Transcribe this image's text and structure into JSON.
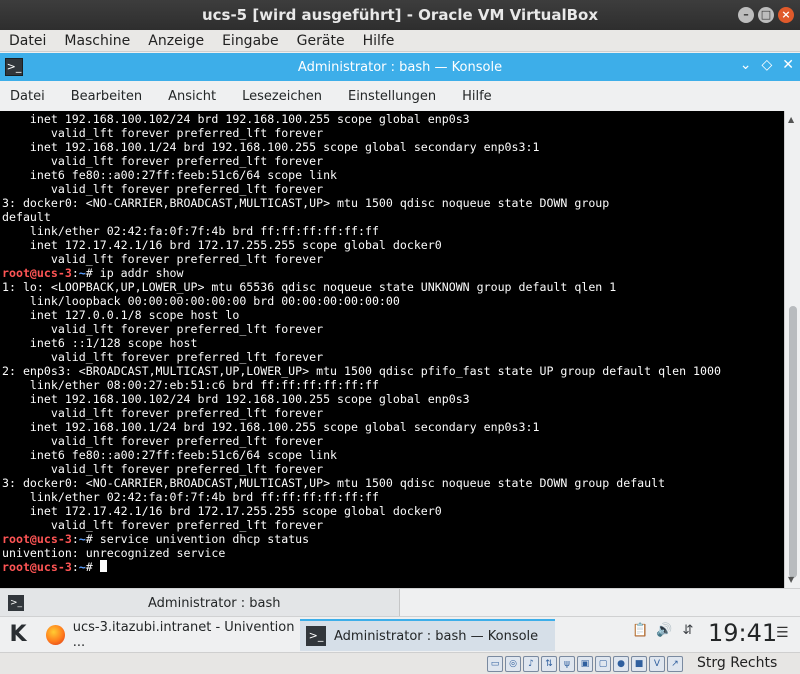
{
  "vbox": {
    "title": "ucs-5 [wird ausgeführt] - Oracle VM VirtualBox",
    "menu": [
      "Datei",
      "Maschine",
      "Anzeige",
      "Eingabe",
      "Geräte",
      "Hilfe"
    ],
    "host_key": "Strg Rechts"
  },
  "konsole": {
    "title": "Administrator : bash — Konsole",
    "menu": [
      "Datei",
      "Bearbeiten",
      "Ansicht",
      "Lesezeichen",
      "Einstellungen",
      "Hilfe"
    ],
    "tab_label": "Administrator : bash"
  },
  "terminal": {
    "prompt": {
      "user": "root",
      "host": "ucs-3",
      "path": "~"
    },
    "lines": [
      {
        "text": "    inet 192.168.100.102/24 brd 192.168.100.255 scope global enp0s3"
      },
      {
        "text": "       valid_lft forever preferred_lft forever"
      },
      {
        "text": "    inet 192.168.100.1/24 brd 192.168.100.255 scope global secondary enp0s3:1"
      },
      {
        "text": "       valid_lft forever preferred_lft forever"
      },
      {
        "text": "    inet6 fe80::a00:27ff:feeb:51c6/64 scope link"
      },
      {
        "text": "       valid_lft forever preferred_lft forever"
      },
      {
        "text": "3: docker0: <NO-CARRIER,BROADCAST,MULTICAST,UP> mtu 1500 qdisc noqueue state DOWN group"
      },
      {
        "text": "default"
      },
      {
        "text": "    link/ether 02:42:fa:0f:7f:4b brd ff:ff:ff:ff:ff:ff"
      },
      {
        "text": "    inet 172.17.42.1/16 brd 172.17.255.255 scope global docker0"
      },
      {
        "text": "       valid_lft forever preferred_lft forever"
      },
      {
        "prompt": true,
        "command": " ip addr show"
      },
      {
        "text": "1: lo: <LOOPBACK,UP,LOWER_UP> mtu 65536 qdisc noqueue state UNKNOWN group default qlen 1"
      },
      {
        "text": "    link/loopback 00:00:00:00:00:00 brd 00:00:00:00:00:00"
      },
      {
        "text": "    inet 127.0.0.1/8 scope host lo"
      },
      {
        "text": "       valid_lft forever preferred_lft forever"
      },
      {
        "text": "    inet6 ::1/128 scope host"
      },
      {
        "text": "       valid_lft forever preferred_lft forever"
      },
      {
        "text": "2: enp0s3: <BROADCAST,MULTICAST,UP,LOWER_UP> mtu 1500 qdisc pfifo_fast state UP group default qlen 1000"
      },
      {
        "text": "    link/ether 08:00:27:eb:51:c6 brd ff:ff:ff:ff:ff:ff"
      },
      {
        "text": "    inet 192.168.100.102/24 brd 192.168.100.255 scope global enp0s3"
      },
      {
        "text": "       valid_lft forever preferred_lft forever"
      },
      {
        "text": "    inet 192.168.100.1/24 brd 192.168.100.255 scope global secondary enp0s3:1"
      },
      {
        "text": "       valid_lft forever preferred_lft forever"
      },
      {
        "text": "    inet6 fe80::a00:27ff:feeb:51c6/64 scope link"
      },
      {
        "text": "       valid_lft forever preferred_lft forever"
      },
      {
        "text": "3: docker0: <NO-CARRIER,BROADCAST,MULTICAST,UP> mtu 1500 qdisc noqueue state DOWN group default"
      },
      {
        "text": "    link/ether 02:42:fa:0f:7f:4b brd ff:ff:ff:ff:ff:ff"
      },
      {
        "text": "    inet 172.17.42.1/16 brd 172.17.255.255 scope global docker0"
      },
      {
        "text": "       valid_lft forever preferred_lft forever"
      },
      {
        "prompt": true,
        "command": " service univention dhcp status"
      },
      {
        "text": "univention: unrecognized service"
      },
      {
        "prompt": true,
        "command": " ",
        "cursor": true
      }
    ]
  },
  "taskbar": {
    "tasks": [
      {
        "label": "ucs-3.itazubi.intranet - Univention ...",
        "icon": "firefox-icon"
      },
      {
        "label": "Administrator : bash — Konsole",
        "icon": "konsole-icon",
        "active": true
      }
    ],
    "tray_icons": [
      "clipboard-icon",
      "volume-icon",
      "network-icon"
    ],
    "clock": "19:41"
  },
  "status_icons": [
    "harddisk-icon",
    "optical-drive-icon",
    "audio-icon",
    "network-icon",
    "usb-icon",
    "shared-folders-icon",
    "display-icon",
    "video-capture-icon",
    "cpu-icon",
    "virtualization-icon",
    "mouse-integration-icon"
  ],
  "colors": {
    "konsole_accent": "#3daee9",
    "terminal_bg": "#000000",
    "terminal_fg": "#fcfcfc",
    "prompt_user": "#ff5555",
    "prompt_path": "#5c9fff"
  }
}
